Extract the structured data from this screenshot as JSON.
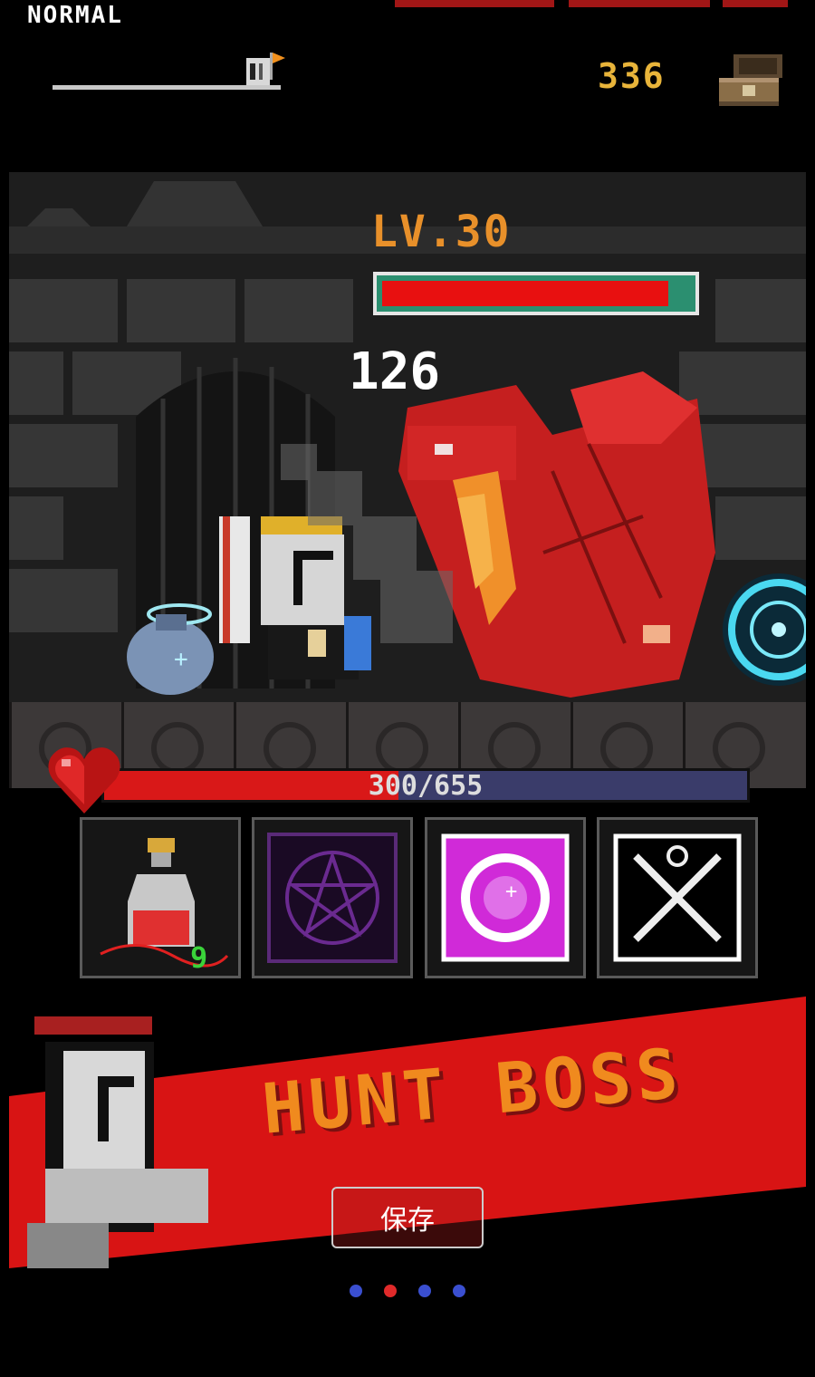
{
  "hud": {
    "difficulty": "NORMAL",
    "gold": "336",
    "stage_progress": 0.9
  },
  "boss": {
    "level_label": "LV.30",
    "hp_fraction": 0.93,
    "damage": "126"
  },
  "player": {
    "hp_text": "300/655",
    "hp_current": 300,
    "hp_max": 655
  },
  "skills": {
    "items": [
      {
        "name": "potion",
        "count": "9"
      },
      {
        "name": "pentagram-seal"
      },
      {
        "name": "orb-burst"
      },
      {
        "name": "crossed-swords"
      }
    ]
  },
  "banner": {
    "title": "HUNT BOSS",
    "save_label": "保存"
  },
  "pager": {
    "active_index": 1,
    "count": 4,
    "active_color": "#e02a2a",
    "inactive_color": "#3a4fd0"
  },
  "colors": {
    "accent_red": "#d91818",
    "gold": "#e8b43a",
    "boss_level": "#e8902a",
    "banner_text": "#f08a1e"
  }
}
